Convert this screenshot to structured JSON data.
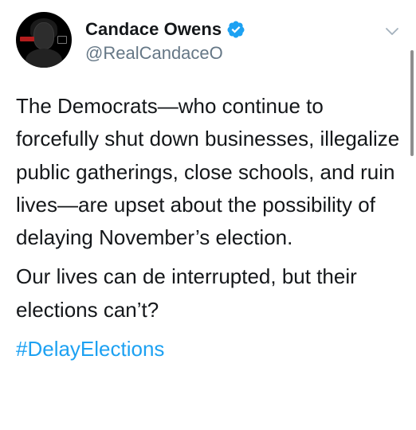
{
  "tweet": {
    "author": {
      "display_name": "Candace Owens",
      "handle": "@RealCandaceO",
      "verified": true
    },
    "paragraphs": [
      "The Democrats—who continue to forcefully shut down businesses, illegalize public gatherings, close schools, and ruin lives—are upset about the possibility of delaying November’s election.",
      "Our lives can de interrupted, but their elections can’t?"
    ],
    "hashtag": "#DelayElections"
  },
  "icons": {
    "verified": "verified-badge-icon",
    "menu": "chevron-down-icon"
  },
  "colors": {
    "verified": "#1da1f2",
    "hashtag": "#1da1f2",
    "handle": "#657786",
    "text": "#14171a"
  }
}
